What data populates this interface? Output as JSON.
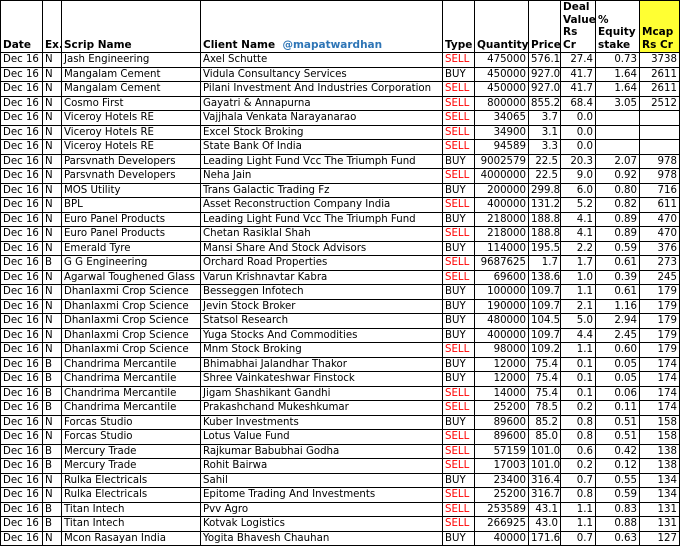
{
  "headers": {
    "date": "Date",
    "exchange": "Ex.",
    "scrip": "Scrip Name",
    "client": "Client Name",
    "handle": "@mapatwardhan",
    "type": "Type",
    "quantity": "Quantity",
    "price": "Price",
    "deal_value_line1": "Deal",
    "deal_value_line2": "Value",
    "deal_value_line3": "Rs Cr",
    "equity_line1": "%",
    "equity_line2": "Equity",
    "equity_line3": "stake",
    "mcap_line1": "Mcap",
    "mcap_line2": "Rs Cr"
  },
  "colors": {
    "sell": "#ff0000",
    "buy": "#000000",
    "mcap_header_bg": "#ffff33",
    "handle": "#2e75b6"
  },
  "rows": [
    {
      "date": "Dec 16",
      "ex": "N",
      "scrip": "Jash Engineering",
      "client": "Axel Schutte",
      "type": "SELL",
      "qty": "475000",
      "price": "576.1",
      "value": "27.4",
      "stake": "0.73",
      "mcap": "3738"
    },
    {
      "date": "Dec 16",
      "ex": "N",
      "scrip": "Mangalam Cement",
      "client": "Vidula Consultancy Services",
      "type": "BUY",
      "qty": "450000",
      "price": "927.0",
      "value": "41.7",
      "stake": "1.64",
      "mcap": "2611"
    },
    {
      "date": "Dec 16",
      "ex": "N",
      "scrip": "Mangalam Cement",
      "client": "Pilani Investment And Industries Corporation",
      "type": "SELL",
      "qty": "450000",
      "price": "927.0",
      "value": "41.7",
      "stake": "1.64",
      "mcap": "2611"
    },
    {
      "date": "Dec 16",
      "ex": "N",
      "scrip": "Cosmo First",
      "client": "Gayatri & Annapurna",
      "type": "SELL",
      "qty": "800000",
      "price": "855.2",
      "value": "68.4",
      "stake": "3.05",
      "mcap": "2512"
    },
    {
      "date": "Dec 16",
      "ex": "N",
      "scrip": "Viceroy Hotels  RE",
      "client": "Vajjhala Venkata Narayanarao",
      "type": "SELL",
      "qty": "34065",
      "price": "3.7",
      "value": "0.0",
      "stake": "",
      "mcap": ""
    },
    {
      "date": "Dec 16",
      "ex": "N",
      "scrip": "Viceroy Hotels  RE",
      "client": "Excel Stock Broking",
      "type": "SELL",
      "qty": "34900",
      "price": "3.1",
      "value": "0.0",
      "stake": "",
      "mcap": ""
    },
    {
      "date": "Dec 16",
      "ex": "N",
      "scrip": "Viceroy Hotels  RE",
      "client": "State Bank Of India",
      "type": "SELL",
      "qty": "94589",
      "price": "3.3",
      "value": "0.0",
      "stake": "",
      "mcap": ""
    },
    {
      "date": "Dec 16",
      "ex": "N",
      "scrip": "Parsvnath Developers",
      "client": "Leading Light Fund Vcc The Triumph Fund",
      "type": "BUY",
      "qty": "9002579",
      "price": "22.5",
      "value": "20.3",
      "stake": "2.07",
      "mcap": "978"
    },
    {
      "date": "Dec 16",
      "ex": "N",
      "scrip": "Parsvnath Developers",
      "client": "Neha Jain",
      "type": "SELL",
      "qty": "4000000",
      "price": "22.5",
      "value": "9.0",
      "stake": "0.92",
      "mcap": "978"
    },
    {
      "date": "Dec 16",
      "ex": "N",
      "scrip": "MOS Utility",
      "client": "Trans Galactic Trading Fz",
      "type": "BUY",
      "qty": "200000",
      "price": "299.8",
      "value": "6.0",
      "stake": "0.80",
      "mcap": "716"
    },
    {
      "date": "Dec 16",
      "ex": "N",
      "scrip": "BPL",
      "client": "Asset Reconstruction Company India",
      "type": "SELL",
      "qty": "400000",
      "price": "131.2",
      "value": "5.2",
      "stake": "0.82",
      "mcap": "611"
    },
    {
      "date": "Dec 16",
      "ex": "N",
      "scrip": "Euro Panel Products",
      "client": "Leading Light Fund Vcc The Triumph Fund",
      "type": "BUY",
      "qty": "218000",
      "price": "188.8",
      "value": "4.1",
      "stake": "0.89",
      "mcap": "470"
    },
    {
      "date": "Dec 16",
      "ex": "N",
      "scrip": "Euro Panel Products",
      "client": "Chetan Rasiklal Shah",
      "type": "SELL",
      "qty": "218000",
      "price": "188.8",
      "value": "4.1",
      "stake": "0.89",
      "mcap": "470"
    },
    {
      "date": "Dec 16",
      "ex": "N",
      "scrip": "Emerald Tyre",
      "client": "Mansi Share And Stock Advisors",
      "type": "BUY",
      "qty": "114000",
      "price": "195.5",
      "value": "2.2",
      "stake": "0.59",
      "mcap": "376"
    },
    {
      "date": "Dec 16",
      "ex": "B",
      "scrip": "G G Engineering",
      "client": "Orchard Road Properties",
      "type": "SELL",
      "qty": "9687625",
      "price": "1.7",
      "value": "1.7",
      "stake": "0.61",
      "mcap": "273"
    },
    {
      "date": "Dec 16",
      "ex": "N",
      "scrip": "Agarwal Toughened Glass",
      "client": "Varun Krishnavtar Kabra",
      "type": "SELL",
      "qty": "69600",
      "price": "138.6",
      "value": "1.0",
      "stake": "0.39",
      "mcap": "245"
    },
    {
      "date": "Dec 16",
      "ex": "N",
      "scrip": "Dhanlaxmi Crop Science",
      "client": "Besseggen Infotech",
      "type": "BUY",
      "qty": "100000",
      "price": "109.7",
      "value": "1.1",
      "stake": "0.61",
      "mcap": "179"
    },
    {
      "date": "Dec 16",
      "ex": "N",
      "scrip": "Dhanlaxmi Crop Science",
      "client": "Jevin Stock Broker",
      "type": "BUY",
      "qty": "190000",
      "price": "109.7",
      "value": "2.1",
      "stake": "1.16",
      "mcap": "179"
    },
    {
      "date": "Dec 16",
      "ex": "N",
      "scrip": "Dhanlaxmi Crop Science",
      "client": "Statsol Research",
      "type": "BUY",
      "qty": "480000",
      "price": "104.5",
      "value": "5.0",
      "stake": "2.94",
      "mcap": "179"
    },
    {
      "date": "Dec 16",
      "ex": "N",
      "scrip": "Dhanlaxmi Crop Science",
      "client": "Yuga Stocks And Commodities",
      "type": "BUY",
      "qty": "400000",
      "price": "109.7",
      "value": "4.4",
      "stake": "2.45",
      "mcap": "179"
    },
    {
      "date": "Dec 16",
      "ex": "N",
      "scrip": "Dhanlaxmi Crop Science",
      "client": "Mnm Stock Broking",
      "type": "SELL",
      "qty": "98000",
      "price": "109.2",
      "value": "1.1",
      "stake": "0.60",
      "mcap": "179"
    },
    {
      "date": "Dec 16",
      "ex": "B",
      "scrip": "Chandrima Mercantile",
      "client": "Bhimabhai Jalandhar Thakor",
      "type": "BUY",
      "qty": "12000",
      "price": "75.4",
      "value": "0.1",
      "stake": "0.05",
      "mcap": "174"
    },
    {
      "date": "Dec 16",
      "ex": "B",
      "scrip": "Chandrima Mercantile",
      "client": "Shree Vainkateshwar Finstock",
      "type": "BUY",
      "qty": "12000",
      "price": "75.4",
      "value": "0.1",
      "stake": "0.05",
      "mcap": "174"
    },
    {
      "date": "Dec 16",
      "ex": "B",
      "scrip": "Chandrima Mercantile",
      "client": "Jigam Shashikant Gandhi",
      "type": "SELL",
      "qty": "14000",
      "price": "75.4",
      "value": "0.1",
      "stake": "0.06",
      "mcap": "174"
    },
    {
      "date": "Dec 16",
      "ex": "B",
      "scrip": "Chandrima Mercantile",
      "client": "Prakashchand Mukeshkumar",
      "type": "SELL",
      "qty": "25200",
      "price": "78.5",
      "value": "0.2",
      "stake": "0.11",
      "mcap": "174"
    },
    {
      "date": "Dec 16",
      "ex": "N",
      "scrip": "Forcas Studio",
      "client": "Kuber Investments",
      "type": "BUY",
      "qty": "89600",
      "price": "85.2",
      "value": "0.8",
      "stake": "0.51",
      "mcap": "158"
    },
    {
      "date": "Dec 16",
      "ex": "N",
      "scrip": "Forcas Studio",
      "client": "Lotus Value Fund",
      "type": "SELL",
      "qty": "89600",
      "price": "85.0",
      "value": "0.8",
      "stake": "0.51",
      "mcap": "158"
    },
    {
      "date": "Dec 16",
      "ex": "B",
      "scrip": "Mercury Trade",
      "client": "Rajkumar Babubhai Godha",
      "type": "SELL",
      "qty": "57159",
      "price": "101.0",
      "value": "0.6",
      "stake": "0.42",
      "mcap": "138"
    },
    {
      "date": "Dec 16",
      "ex": "B",
      "scrip": "Mercury Trade",
      "client": "Rohit Bairwa",
      "type": "SELL",
      "qty": "17003",
      "price": "101.0",
      "value": "0.2",
      "stake": "0.12",
      "mcap": "138"
    },
    {
      "date": "Dec 16",
      "ex": "N",
      "scrip": "Rulka Electricals",
      "client": "Sahil",
      "type": "BUY",
      "qty": "23400",
      "price": "316.4",
      "value": "0.7",
      "stake": "0.55",
      "mcap": "134"
    },
    {
      "date": "Dec 16",
      "ex": "N",
      "scrip": "Rulka Electricals",
      "client": "Epitome Trading And Investments",
      "type": "SELL",
      "qty": "25200",
      "price": "316.7",
      "value": "0.8",
      "stake": "0.59",
      "mcap": "134"
    },
    {
      "date": "Dec 16",
      "ex": "B",
      "scrip": "Titan Intech",
      "client": "Pvv Agro",
      "type": "SELL",
      "qty": "253589",
      "price": "43.1",
      "value": "1.1",
      "stake": "0.83",
      "mcap": "131"
    },
    {
      "date": "Dec 16",
      "ex": "B",
      "scrip": "Titan Intech",
      "client": "Kotvak Logistics",
      "type": "SELL",
      "qty": "266925",
      "price": "43.0",
      "value": "1.1",
      "stake": "0.88",
      "mcap": "131"
    },
    {
      "date": "Dec 16",
      "ex": "N",
      "scrip": "Mcon Rasayan India",
      "client": "Yogita Bhavesh Chauhan",
      "type": "BUY",
      "qty": "40000",
      "price": "171.6",
      "value": "0.7",
      "stake": "0.63",
      "mcap": "127"
    }
  ]
}
